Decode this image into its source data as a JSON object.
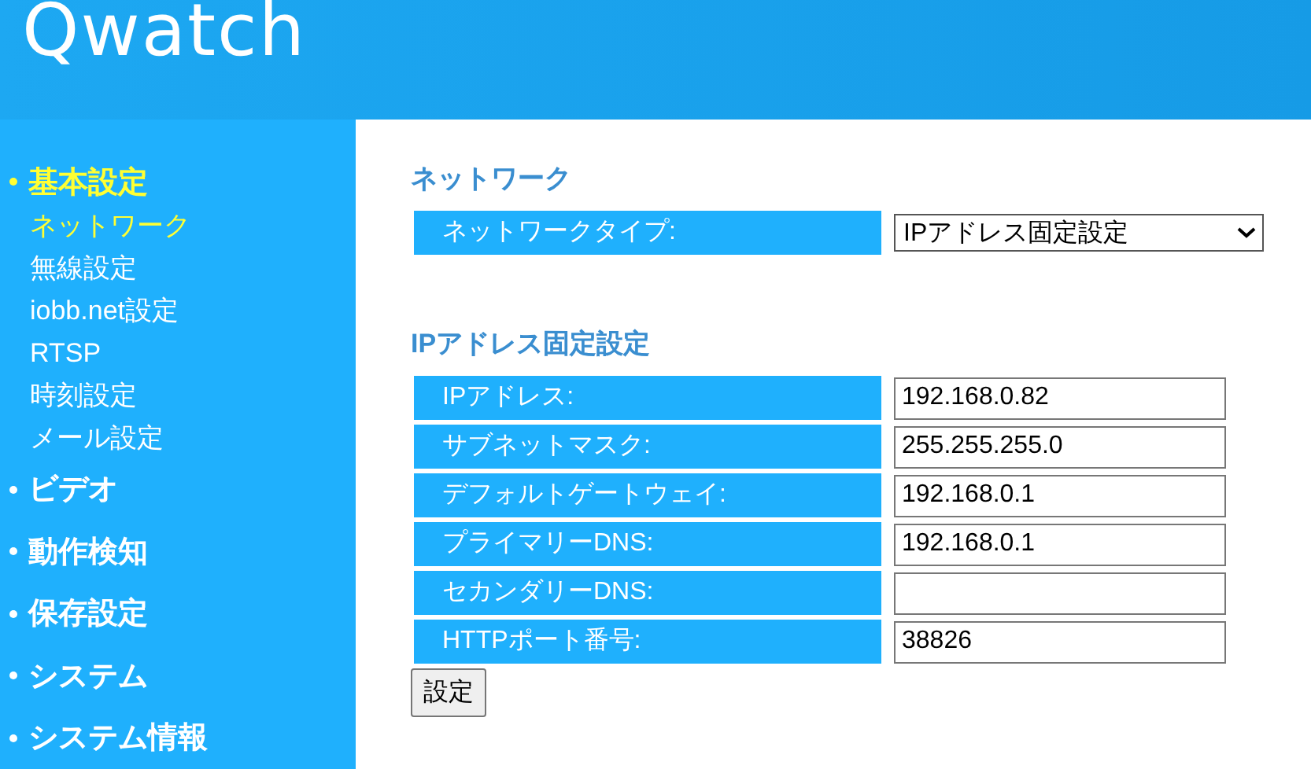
{
  "header": {
    "logo": "Qwatch"
  },
  "sidebar": {
    "sections": [
      {
        "label": "基本設定",
        "selected": true,
        "children": [
          {
            "label": "ネットワーク",
            "selected": true
          },
          {
            "label": "無線設定",
            "selected": false
          },
          {
            "label": "iobb.net設定",
            "selected": false
          },
          {
            "label": "RTSP",
            "selected": false
          },
          {
            "label": "時刻設定",
            "selected": false
          },
          {
            "label": "メール設定",
            "selected": false
          }
        ]
      },
      {
        "label": "ビデオ",
        "selected": false
      },
      {
        "label": "動作検知",
        "selected": false
      },
      {
        "label": "保存設定",
        "selected": false
      },
      {
        "label": "システム",
        "selected": false
      },
      {
        "label": "システム情報",
        "selected": false
      }
    ]
  },
  "network": {
    "title": "ネットワーク",
    "type_label": "ネットワークタイプ:",
    "type_value": "IPアドレス固定設定"
  },
  "static_ip": {
    "title": "IPアドレス固定設定",
    "fields": [
      {
        "label": "IPアドレス:",
        "value": "192.168.0.82"
      },
      {
        "label": "サブネットマスク:",
        "value": "255.255.255.0"
      },
      {
        "label": "デフォルトゲートウェイ:",
        "value": "192.168.0.1"
      },
      {
        "label": "プライマリーDNS:",
        "value": "192.168.0.1"
      },
      {
        "label": "セカンダリーDNS:"
      },
      {
        "label": "HTTPポート番号:",
        "value": "38826"
      }
    ]
  },
  "submit": "設定"
}
